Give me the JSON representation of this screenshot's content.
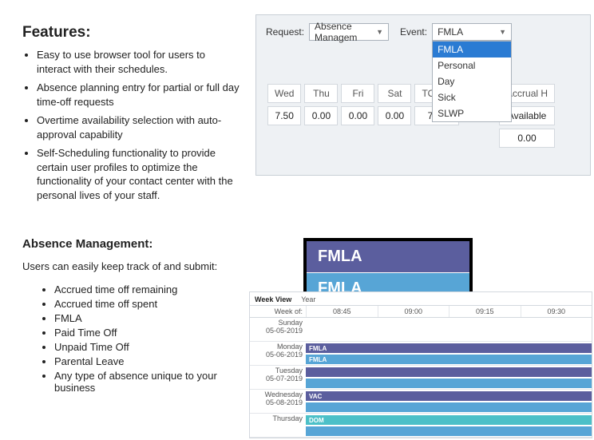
{
  "left": {
    "features_title": "Features:",
    "features": [
      "Easy to use browser tool for users to interact with their schedules.",
      "Absence planning entry for partial or full day time-off requests",
      "Overtime availability selection with auto-approval capability",
      "Self-Scheduling functionality to provide certain user profiles to optimize the functionality of your contact center with the personal lives of your staff."
    ],
    "abs_title": "Absence Management:",
    "abs_intro": "Users can easily keep track of and submit:",
    "abs_items": [
      "Accrued time off remaining",
      "Accrued time off spent",
      "FMLA",
      "Paid Time Off",
      "Unpaid Time Off",
      "Parental Leave",
      "Any type of absence unique to your business"
    ]
  },
  "app_top": {
    "request_label": "Request:",
    "request_value": "Absence Managem",
    "event_label": "Event:",
    "event_selected": "FMLA",
    "event_options": [
      "FMLA",
      "Personal",
      "Day",
      "Sick",
      "SLWP"
    ],
    "table_headers": [
      "Wed",
      "Thu",
      "Fri",
      "Sat",
      "TOTAL"
    ],
    "table_values": [
      "7.50",
      "0.00",
      "0.00",
      "0.00",
      "7.50"
    ],
    "right_headers": [
      "Accrual H",
      "Available"
    ],
    "right_values": [
      "0.00"
    ]
  },
  "app_bot": {
    "tabs": [
      "Week View",
      "Year"
    ],
    "week_of_label": "Week of:",
    "time_ticks": [
      "08:45",
      "09:00",
      "09:15",
      "09:30"
    ],
    "days": [
      {
        "dow": "Sunday",
        "date": "05-05-2019",
        "bars": []
      },
      {
        "dow": "Monday",
        "date": "05-06-2019",
        "bars": [
          {
            "cls": "c-purple top",
            "txt": "FMLA"
          },
          {
            "cls": "c-blue bot",
            "txt": "FMLA"
          }
        ]
      },
      {
        "dow": "Tuesday",
        "date": "05-07-2019",
        "bars": [
          {
            "cls": "c-purple top",
            "txt": ""
          },
          {
            "cls": "c-blue bot",
            "txt": ""
          }
        ]
      },
      {
        "dow": "Wednesday",
        "date": "05-08-2019",
        "bars": [
          {
            "cls": "c-purple top",
            "txt": "VAC"
          },
          {
            "cls": "c-blue bot",
            "txt": ""
          }
        ]
      },
      {
        "dow": "Thursday",
        "date": "",
        "bars": [
          {
            "cls": "c-teal top",
            "txt": "DOM"
          },
          {
            "cls": "c-blue bot",
            "txt": ""
          }
        ]
      }
    ]
  },
  "callout": {
    "line1": "FMLA",
    "line2": "FMLA"
  }
}
